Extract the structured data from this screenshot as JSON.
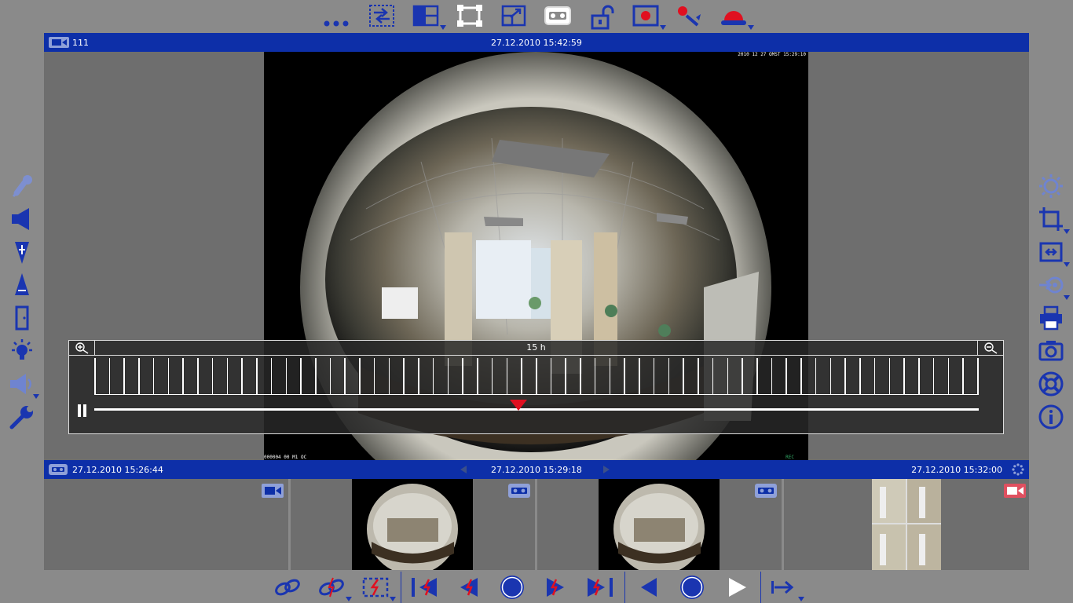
{
  "main_view": {
    "camera_name": "111",
    "timestamp": "27.12.2010 15:42:59",
    "overlay_timestamp": "2010 12 27 OMST 15:29:10",
    "overlay_footer": "000004 00 M1 OC",
    "overlay_rec": "REC"
  },
  "timeline": {
    "scale_label": "15 h",
    "zoom_in": "zoom-in",
    "zoom_out": "zoom-out",
    "position": 0.48
  },
  "archive_bar": {
    "start_time": "27.12.2010 15:26:44",
    "current_time": "27.12.2010 15:29:18",
    "end_time": "27.12.2010 15:32:00"
  },
  "colors": {
    "accent_blue": "#0d2fa8",
    "icon_blue": "#1a35b0",
    "marker_red": "#e01020",
    "background": "#8a8a8a",
    "panel": "#6e6e6e"
  },
  "top_toolbar": [
    "more-icon",
    "layout-sequence-icon",
    "layout-split-icon",
    "fullscreen-icon",
    "window-resize-icon",
    "archive-icon",
    "unlock-icon",
    "record-icon",
    "record-settings-icon",
    "alarm-icon"
  ],
  "left_toolbar": [
    "microphone-icon",
    "speaker-icon",
    "focus-far-icon",
    "focus-near-icon",
    "door-icon",
    "light-icon",
    "loudspeaker-icon",
    "wrench-icon"
  ],
  "right_toolbar": [
    "brightness-icon",
    "crop-icon",
    "fit-icon",
    "ptz-preset-icon",
    "print-icon",
    "snapshot-icon",
    "help-icon",
    "info-icon"
  ],
  "bottom_toolbar": [
    "link-icon",
    "link-alarm-icon",
    "select-alarm-icon",
    "first-alarm-icon",
    "prev-alarm-icon",
    "stop-icon",
    "next-alarm-icon",
    "last-alarm-icon",
    "play-backward-icon",
    "pause-icon",
    "play-forward-icon",
    "goto-time-icon"
  ]
}
